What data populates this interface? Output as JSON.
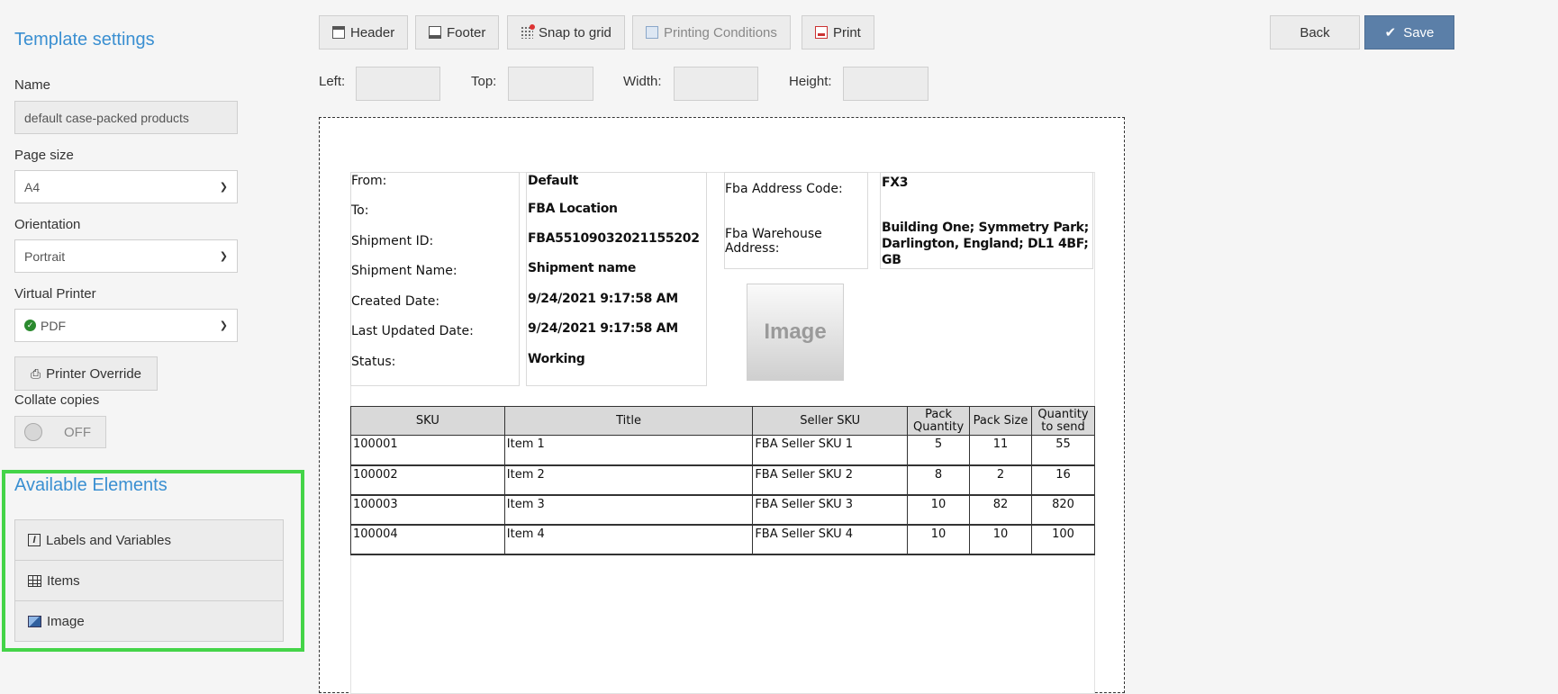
{
  "settings": {
    "title": "Template settings",
    "name_label": "Name",
    "name_value": "default case-packed products",
    "page_size_label": "Page size",
    "page_size_value": "A4",
    "orientation_label": "Orientation",
    "orientation_value": "Portrait",
    "virtual_printer_label": "Virtual Printer",
    "virtual_printer_value": "PDF",
    "printer_override_label": "Printer Override",
    "collate_label": "Collate copies",
    "collate_state": "OFF"
  },
  "available_elements": {
    "title": "Available Elements",
    "items": [
      {
        "label": "Labels and Variables",
        "icon": "label-variable-icon"
      },
      {
        "label": "Items",
        "icon": "table-icon"
      },
      {
        "label": "Image",
        "icon": "image-icon"
      }
    ]
  },
  "toolbar": {
    "header_label": "Header",
    "footer_label": "Footer",
    "snap_label": "Snap to grid",
    "conditions_label": "Printing Conditions",
    "print_label": "Print",
    "back_label": "Back",
    "save_label": "Save"
  },
  "position": {
    "left_label": "Left:",
    "top_label": "Top:",
    "width_label": "Width:",
    "height_label": "Height:",
    "left_value": "",
    "top_value": "",
    "width_value": "",
    "height_value": ""
  },
  "report": {
    "labels": [
      "From:",
      "To:",
      "Shipment ID:",
      "Shipment Name:",
      "Created Date:",
      "Last Updated Date:",
      "Status:"
    ],
    "values": [
      "Default",
      "FBA Location",
      "FBA55109032021155202",
      "Shipment name",
      "9/24/2021 9:17:58 AM",
      "9/24/2021 9:17:58 AM",
      "Working"
    ],
    "fba_code_label": "Fba Address Code:",
    "fba_warehouse_label": "Fba Warehouse Address:",
    "fba_code_value": "FX3",
    "fba_warehouse_value": "Building One; Symmetry Park; Darlington, England; DL1 4BF; GB",
    "image_placeholder": "Image",
    "table": {
      "columns": [
        "SKU",
        "Title",
        "Seller SKU",
        "Pack Quantity",
        "Pack Size",
        "Quantity to send"
      ],
      "rows": [
        [
          "100001",
          "Item 1",
          "FBA Seller SKU 1",
          "5",
          "11",
          "55"
        ],
        [
          "100002",
          "Item 2",
          "FBA Seller SKU 2",
          "8",
          "2",
          "16"
        ],
        [
          "100003",
          "Item 3",
          "FBA Seller SKU 3",
          "10",
          "82",
          "820"
        ],
        [
          "100004",
          "Item 4",
          "FBA Seller SKU 4",
          "10",
          "10",
          "100"
        ]
      ]
    }
  },
  "colors": {
    "accent": "#3a8fd1",
    "save": "#5b7fa8",
    "highlight": "#44d448"
  }
}
